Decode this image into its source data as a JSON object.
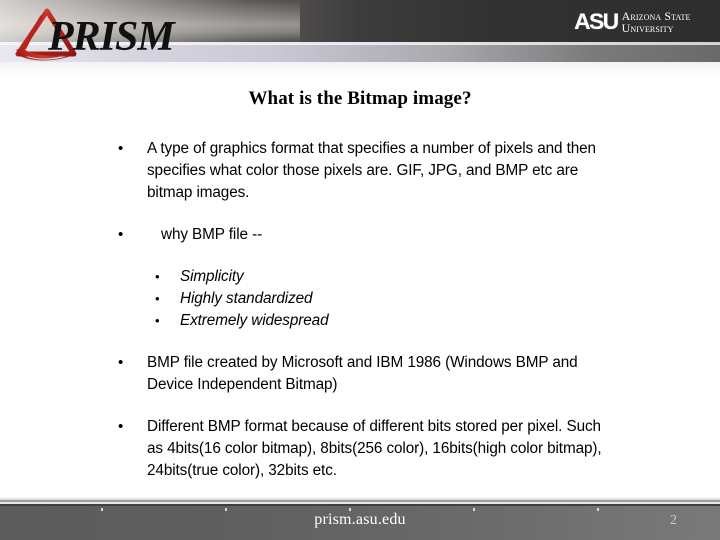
{
  "header": {
    "prism_logo_alt": "PRISM",
    "asu": {
      "mark": "ASU",
      "line1": "Arizona State",
      "line2": "University"
    }
  },
  "slide": {
    "title": "What is the Bitmap image?",
    "bullets": [
      {
        "marker": "•",
        "text": "A type of graphics format that specifies a number of pixels and then specifies what color those pixels are. GIF, JPG, and BMP etc are bitmap images."
      },
      {
        "marker": "•",
        "text": "why BMP file --"
      },
      {
        "marker": "•",
        "text": "BMP file created by Microsoft and IBM 1986 (Windows BMP and Device Independent Bitmap)"
      },
      {
        "marker": "•",
        "text": "Different BMP format because of different bits stored per pixel. Such as 4bits(16 color bitmap), 8bits(256 color), 16bits(high color bitmap), 24bits(true color), 32bits etc."
      }
    ],
    "subbullets": [
      {
        "marker": "•",
        "text": "Simplicity"
      },
      {
        "marker": "•",
        "text": "Highly standardized"
      },
      {
        "marker": "•",
        "text": "Extremely widespread"
      }
    ]
  },
  "footer": {
    "url": "prism.asu.edu",
    "page_number": "2"
  },
  "colors": {
    "logo_red": "#b01f1f",
    "footer_bar": "#666666",
    "header_dark": "#333232",
    "text": "#000000"
  }
}
